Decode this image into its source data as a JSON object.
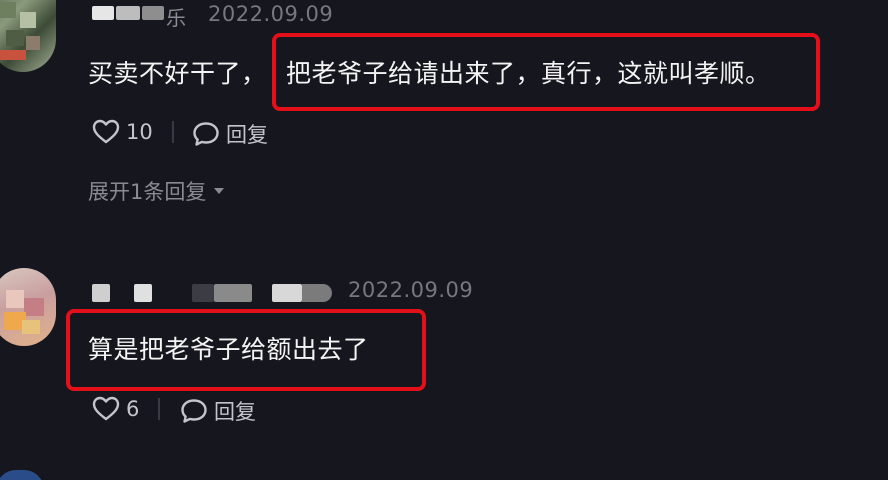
{
  "comments": [
    {
      "username_visible": "乐",
      "date": "2022.09.09",
      "text_plain": "买卖不好干了，",
      "text_highlight": "把老爷子给请出来了，真行，这就叫孝顺。",
      "like_count": "10",
      "reply_label": "回复",
      "expand_label": "展开1条回复"
    },
    {
      "username_visible": "",
      "date": "2022.09.09",
      "text_highlight": "算是把老爷子给额出去了",
      "like_count": "6",
      "reply_label": "回复"
    }
  ],
  "icons": {
    "like": "heart-outline-icon",
    "reply": "speech-bubble-icon",
    "expand": "caret-down-icon"
  },
  "colors": {
    "background": "#16161e",
    "highlight_border": "#e3101a",
    "text_primary": "#f4f4f4",
    "text_secondary": "#8b8b94"
  }
}
